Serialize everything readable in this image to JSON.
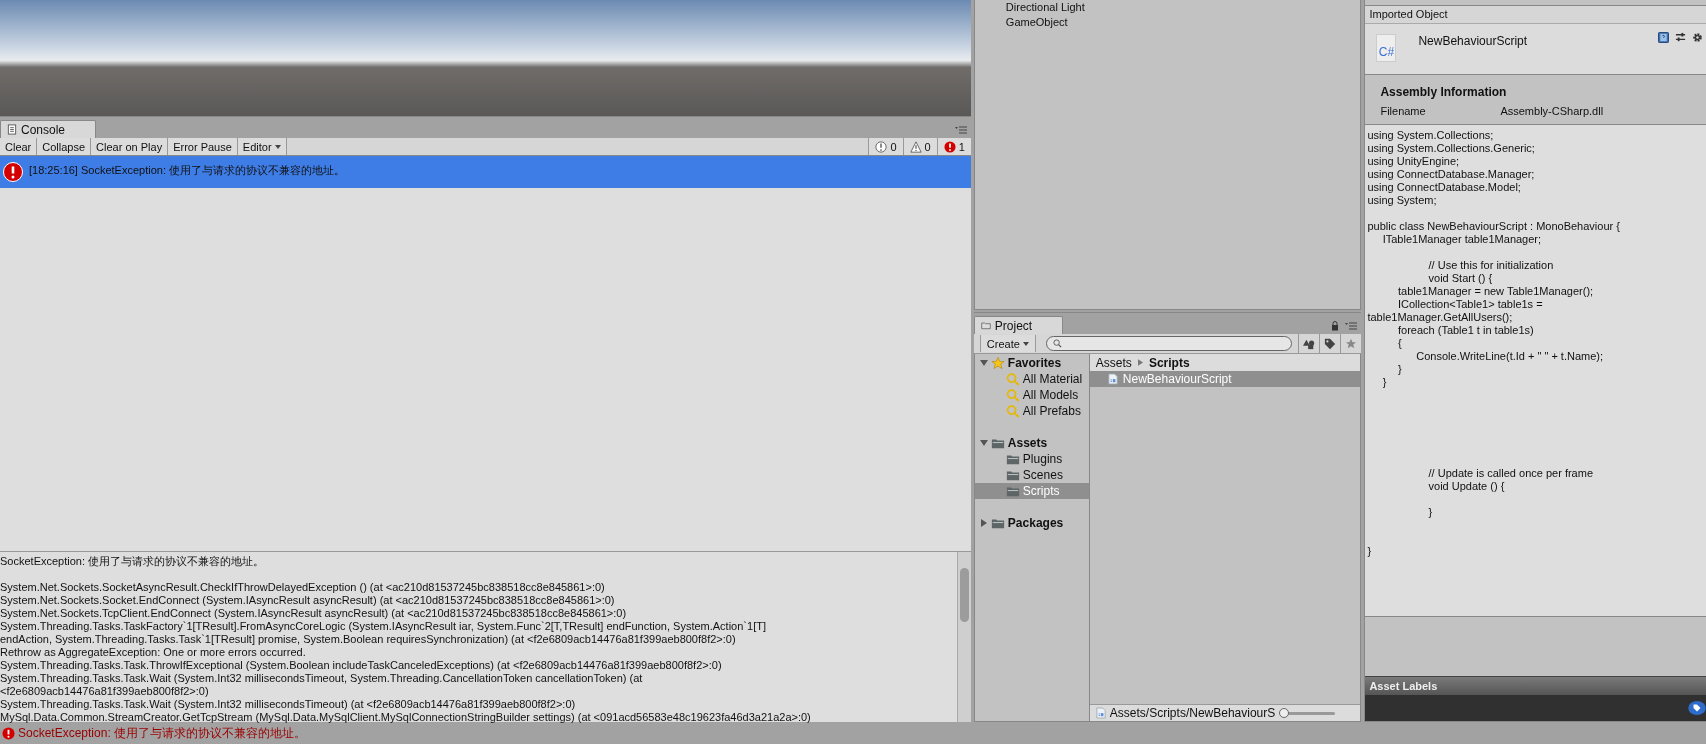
{
  "hierarchy": {
    "items": [
      "Directional Light",
      "GameObject"
    ]
  },
  "console": {
    "tab": "Console",
    "toolbar": [
      {
        "label": "Clear",
        "kind": "button"
      },
      {
        "label": "Collapse",
        "kind": "button"
      },
      {
        "label": "Clear on Play",
        "kind": "button"
      },
      {
        "label": "Error Pause",
        "kind": "button"
      },
      {
        "label": "Editor",
        "kind": "dropdown"
      }
    ],
    "counters": [
      {
        "kind": "info",
        "count": "0"
      },
      {
        "kind": "warning",
        "count": "0"
      },
      {
        "kind": "error",
        "count": "1"
      }
    ],
    "entries": [
      {
        "kind": "error",
        "text": "[18:25:16] SocketException: 使用了与请求的协议不兼容的地址。",
        "selected": true
      }
    ],
    "message": "SocketException: 使用了与请求的协议不兼容的地址。",
    "stack": [
      "System.Net.Sockets.SocketAsyncResult.CheckIfThrowDelayedException () (at <ac210d81537245bc838518cc8e845861>:0)",
      "System.Net.Sockets.Socket.EndConnect (System.IAsyncResult asyncResult) (at <ac210d81537245bc838518cc8e845861>:0)",
      "System.Net.Sockets.TcpClient.EndConnect (System.IAsyncResult asyncResult) (at <ac210d81537245bc838518cc8e845861>:0)",
      "System.Threading.Tasks.TaskFactory`1[TResult].FromAsyncCoreLogic (System.IAsyncResult iar, System.Func`2[T,TResult] endFunction, System.Action`1[T]",
      "endAction, System.Threading.Tasks.Task`1[TResult] promise, System.Boolean requiresSynchronization) (at <f2e6809acb14476a81f399aeb800f8f2>:0)",
      "Rethrow as AggregateException: One or more errors occurred.",
      "System.Threading.Tasks.Task.ThrowIfExceptional (System.Boolean includeTaskCanceledExceptions) (at <f2e6809acb14476a81f399aeb800f8f2>:0)",
      "System.Threading.Tasks.Task.Wait (System.Int32 millisecondsTimeout, System.Threading.CancellationToken cancellationToken) (at",
      "<f2e6809acb14476a81f399aeb800f8f2>:0)",
      "System.Threading.Tasks.Task.Wait (System.Int32 millisecondsTimeout) (at <f2e6809acb14476a81f399aeb800f8f2>:0)",
      "MySql.Data.Common.StreamCreator.GetTcpStream (MySql.Data.MySqlClient.MySqlConnectionStringBuilder settings) (at <091acd56583e48c19623fa46d3a21a2a>:0)"
    ]
  },
  "status_bar": {
    "kind": "error",
    "text": "SocketException: 使用了与请求的协议不兼容的地址。"
  },
  "project": {
    "tab": "Project",
    "create": "Create",
    "tree": [
      {
        "label": "Favorites",
        "kind": "favorites",
        "expanded": true,
        "selected": false,
        "children": [
          {
            "label": "All Material",
            "kind": "search",
            "selected": false
          },
          {
            "label": "All Models",
            "kind": "search",
            "selected": false
          },
          {
            "label": "All Prefabs",
            "kind": "search",
            "selected": false
          }
        ]
      },
      {
        "label": "Assets",
        "kind": "folder",
        "expanded": true,
        "selected": false,
        "children": [
          {
            "label": "Plugins",
            "kind": "folder",
            "selected": false
          },
          {
            "label": "Scenes",
            "kind": "folder",
            "selected": false
          },
          {
            "label": "Scripts",
            "kind": "folder",
            "selected": true
          }
        ]
      },
      {
        "label": "Packages",
        "kind": "folder",
        "expanded": false,
        "selected": false
      }
    ],
    "breadcrumb": [
      "Assets",
      "Scripts"
    ],
    "files": [
      {
        "name": "NewBehaviourScript",
        "selected": true
      }
    ],
    "path": "Assets/Scripts/NewBehaviourS",
    "zoom": {
      "level": 0
    }
  },
  "inspector": {
    "header": "Imported Object",
    "asset_name": "NewBehaviourScript",
    "icon_text": "C#",
    "section_title": "Assembly Information",
    "fields": [
      {
        "label": "Filename",
        "value": "Assembly-CSharp.dll"
      }
    ],
    "source": "using System.Collections;\nusing System.Collections.Generic;\nusing UnityEngine;\nusing ConnectDatabase.Manager;\nusing ConnectDatabase.Model;\nusing System;\n\npublic class NewBehaviourScript : MonoBehaviour {\n     ITable1Manager table1Manager;\n\n                    // Use this for initialization\n                    void Start () {\n          table1Manager = new Table1Manager();\n          ICollection<Table1> table1s =\ntable1Manager.GetAllUsers();\n          foreach (Table1 t in table1s)\n          {\n                Console.WriteLine(t.Id + \" \" + t.Name);\n          }\n     }\n\n\n\n\n\n\n                    // Update is called once per frame\n                    void Update () {\n\n                    }\n\n\n}",
    "labels_title": "Asset Labels"
  }
}
